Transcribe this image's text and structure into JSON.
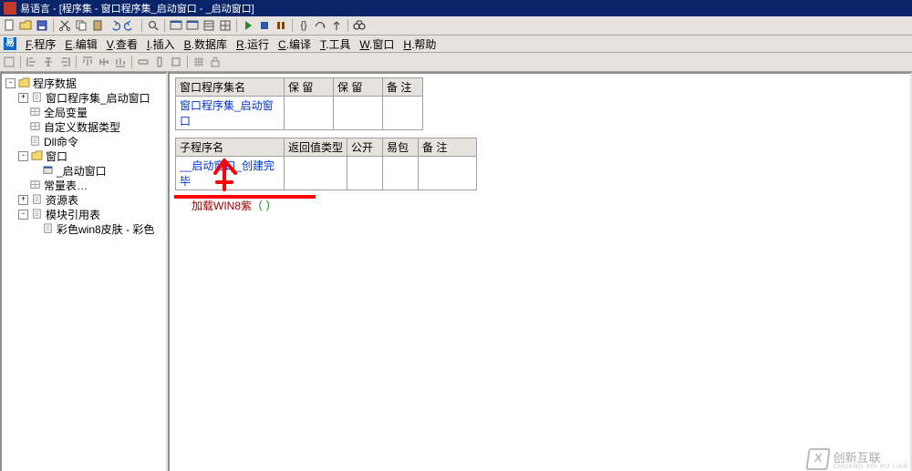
{
  "title": "易语言 - [程序集 - 窗口程序集_启动窗口 - _启动窗口]",
  "menu": {
    "items": [
      {
        "u": "F",
        "label": "程序"
      },
      {
        "u": "E",
        "label": "编辑"
      },
      {
        "u": "V",
        "label": "查看"
      },
      {
        "u": "I",
        "label": "插入"
      },
      {
        "u": "B",
        "label": "数据库"
      },
      {
        "u": "R",
        "label": "运行"
      },
      {
        "u": "C",
        "label": "编译"
      },
      {
        "u": "T",
        "label": "工具"
      },
      {
        "u": "W",
        "label": "窗口"
      },
      {
        "u": "H",
        "label": "帮助"
      }
    ]
  },
  "tree": {
    "root": "程序数据",
    "items": [
      {
        "indent": 0,
        "toggle": "-",
        "icon": "folder",
        "label": "程序数据"
      },
      {
        "indent": 1,
        "toggle": "+",
        "icon": "doc",
        "label": "窗口程序集_启动窗口"
      },
      {
        "indent": 1,
        "toggle": "",
        "icon": "grid",
        "label": "全局变量"
      },
      {
        "indent": 1,
        "toggle": "",
        "icon": "grid",
        "label": "自定义数据类型"
      },
      {
        "indent": 1,
        "toggle": "",
        "icon": "doc",
        "label": "Dll命令"
      },
      {
        "indent": 1,
        "toggle": "-",
        "icon": "folder",
        "label": "窗口"
      },
      {
        "indent": 2,
        "toggle": "",
        "icon": "win",
        "label": "_启动窗口"
      },
      {
        "indent": 1,
        "toggle": "",
        "icon": "grid",
        "label": "常量表…"
      },
      {
        "indent": 1,
        "toggle": "+",
        "icon": "doc",
        "label": "资源表"
      },
      {
        "indent": 1,
        "toggle": "-",
        "icon": "doc",
        "label": "模块引用表"
      },
      {
        "indent": 2,
        "toggle": "",
        "icon": "doc",
        "label": "彩色win8皮肤 - 彩色"
      }
    ]
  },
  "table1": {
    "headers": [
      "窗口程序集名",
      "保 留",
      "保 留",
      "备 注"
    ],
    "row": [
      "窗口程序集_启动窗口",
      "",
      "",
      ""
    ]
  },
  "table2": {
    "headers": [
      "子程序名",
      "返回值类型",
      "公开",
      "易包",
      "备 注"
    ],
    "row": [
      "__启动窗口_创建完毕",
      "",
      "",
      "",
      ""
    ]
  },
  "code": {
    "fn": "加载WIN8紫",
    "paren": "（ ）"
  },
  "watermark": {
    "main": "创新互联",
    "sub": "CHUANG XIN HU LIAN"
  }
}
